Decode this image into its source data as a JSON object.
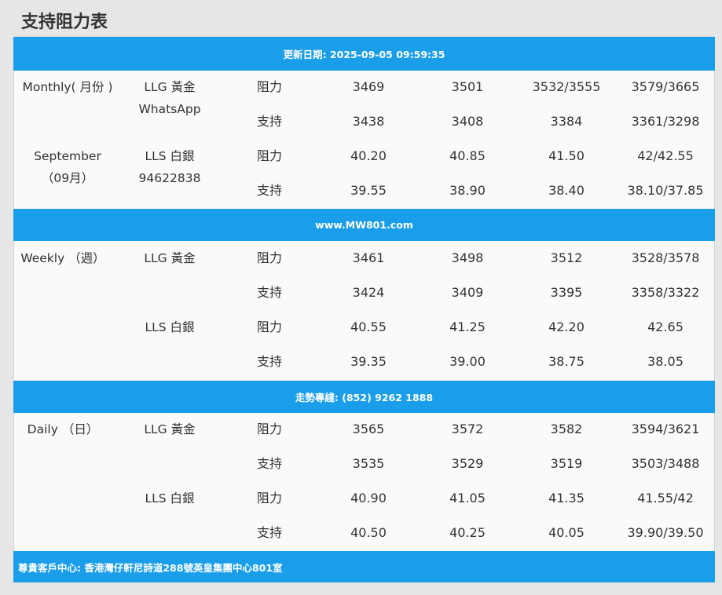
{
  "title": "支持阻力表",
  "header_bar": "更新日期: 2025-09-05 09:59:35",
  "mid_bar_1": "www.MW801.com",
  "mid_bar_2": "走勢專綫: (852) 9262 1888",
  "footer_bar": "尊貴客戶中心: 香港灣仔軒尼詩道288號英皇集團中心801室",
  "monthly": {
    "period_1": "Monthly( 月份 )",
    "period_2": "September",
    "period_3": "（09月）",
    "llg": "LLG 黃金",
    "contact_1": "WhatsApp",
    "lls": "LLS 白銀",
    "contact_2": "94622838",
    "rows": [
      {
        "type": "阻力",
        "v": [
          "3469",
          "3501",
          "3532/3555",
          "3579/3665"
        ]
      },
      {
        "type": "支持",
        "v": [
          "3438",
          "3408",
          "3384",
          "3361/3298"
        ]
      },
      {
        "type": "阻力",
        "v": [
          "40.20",
          "40.85",
          "41.50",
          "42/42.55"
        ]
      },
      {
        "type": "支持",
        "v": [
          "39.55",
          "38.90",
          "38.40",
          "38.10/37.85"
        ]
      }
    ]
  },
  "weekly": {
    "period_1": "Weekly （週）",
    "llg": "LLG 黃金",
    "lls": "LLS 白銀",
    "rows": [
      {
        "type": "阻力",
        "v": [
          "3461",
          "3498",
          "3512",
          "3528/3578"
        ]
      },
      {
        "type": "支持",
        "v": [
          "3424",
          "3409",
          "3395",
          "3358/3322"
        ]
      },
      {
        "type": "阻力",
        "v": [
          "40.55",
          "41.25",
          "42.20",
          "42.65"
        ]
      },
      {
        "type": "支持",
        "v": [
          "39.35",
          "39.00",
          "38.75",
          "38.05"
        ]
      }
    ]
  },
  "daily": {
    "period_1": "Daily （日）",
    "llg": "LLG 黃金",
    "lls": "LLS 白銀",
    "rows": [
      {
        "type": "阻力",
        "v": [
          "3565",
          "3572",
          "3582",
          "3594/3621"
        ]
      },
      {
        "type": "支持",
        "v": [
          "3535",
          "3529",
          "3519",
          "3503/3488"
        ]
      },
      {
        "type": "阻力",
        "v": [
          "40.90",
          "41.05",
          "41.35",
          "41.55/42"
        ]
      },
      {
        "type": "支持",
        "v": [
          "40.50",
          "40.25",
          "40.05",
          "39.90/39.50"
        ]
      }
    ]
  }
}
